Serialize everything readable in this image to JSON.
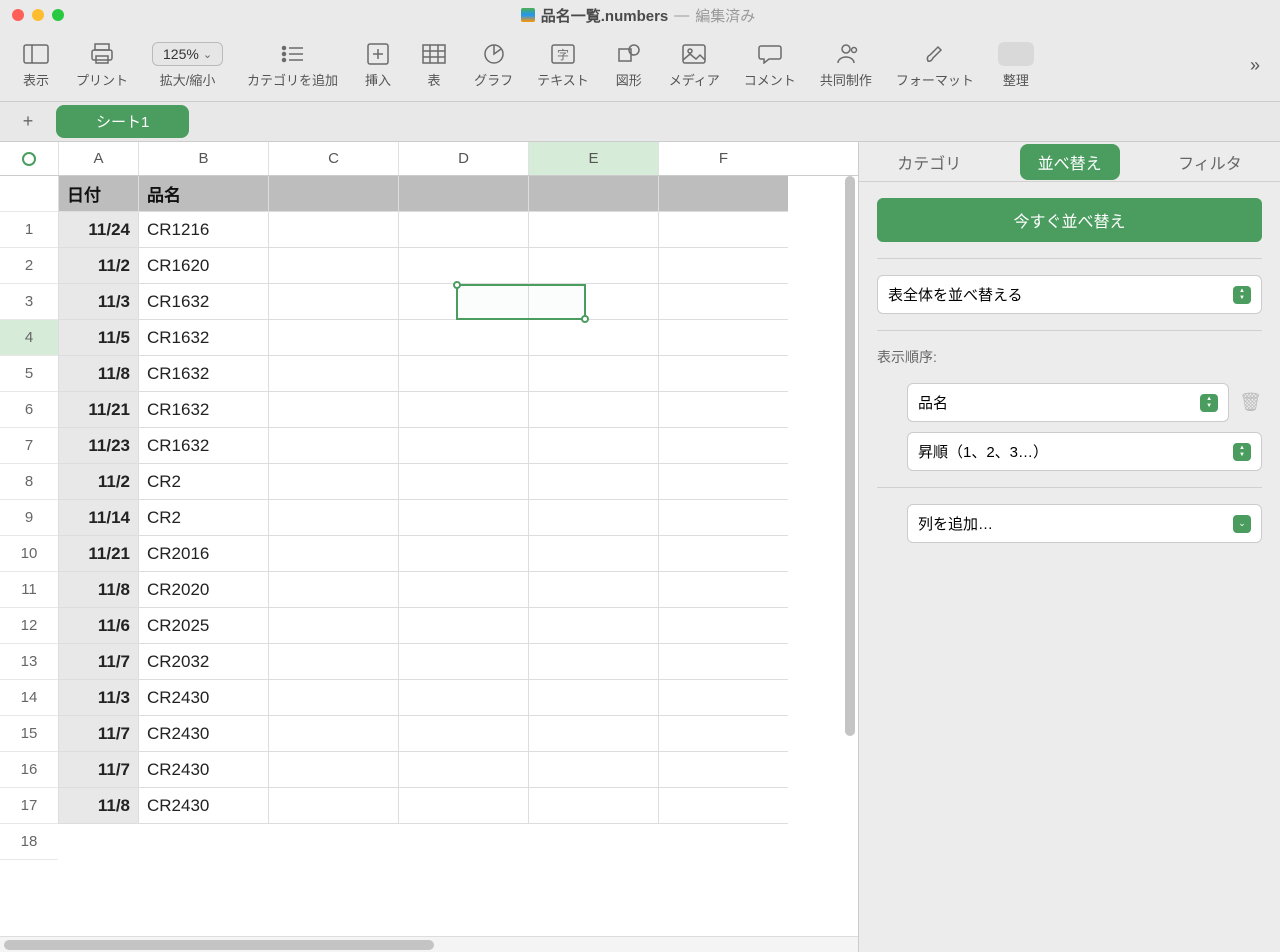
{
  "title": {
    "filename": "品名一覧.numbers",
    "status": "編集済み",
    "separator": "—"
  },
  "toolbar": {
    "view": "表示",
    "print": "プリント",
    "zoom": "拡大/縮小",
    "zoom_value": "125%",
    "category": "カテゴリを追加",
    "insert": "挿入",
    "table": "表",
    "chart": "グラフ",
    "text": "テキスト",
    "shape": "図形",
    "media": "メディア",
    "comment": "コメント",
    "collab": "共同制作",
    "format": "フォーマット",
    "organize": "整理"
  },
  "sheet": {
    "name": "シート1"
  },
  "columns": [
    "A",
    "B",
    "C",
    "D",
    "E",
    "F"
  ],
  "headers": {
    "date": "日付",
    "name": "品名"
  },
  "rows": [
    [
      "11/24",
      "CR1216"
    ],
    [
      "11/2",
      "CR1620"
    ],
    [
      "11/3",
      "CR1632"
    ],
    [
      "11/5",
      "CR1632"
    ],
    [
      "11/8",
      "CR1632"
    ],
    [
      "11/21",
      "CR1632"
    ],
    [
      "11/23",
      "CR1632"
    ],
    [
      "11/2",
      "CR2"
    ],
    [
      "11/14",
      "CR2"
    ],
    [
      "11/21",
      "CR2016"
    ],
    [
      "11/8",
      "CR2020"
    ],
    [
      "11/6",
      "CR2025"
    ],
    [
      "11/7",
      "CR2032"
    ],
    [
      "11/3",
      "CR2430"
    ],
    [
      "11/7",
      "CR2430"
    ],
    [
      "11/7",
      "CR2430"
    ],
    [
      "11/8",
      "CR2430"
    ]
  ],
  "inspector": {
    "tabs": {
      "category": "カテゴリ",
      "sort": "並べ替え",
      "filter": "フィルタ"
    },
    "sort_now": "今すぐ並べ替え",
    "scope": "表全体を並べ替える",
    "order_label": "表示順序:",
    "sort_col": "品名",
    "sort_dir": "昇順（1、2、3…）",
    "add_col": "列を追加…"
  }
}
